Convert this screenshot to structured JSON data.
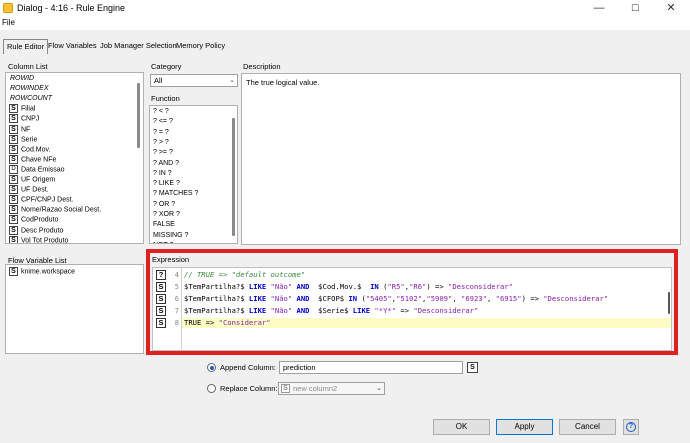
{
  "window": {
    "title": "Dialog - 4:16 - Rule Engine",
    "min": "—",
    "max": "☐",
    "close": "✕"
  },
  "menu": {
    "file": "File"
  },
  "tabs": [
    "Rule Editor",
    "Flow Variables",
    "Job Manager Selection",
    "Memory Policy"
  ],
  "column_list": {
    "label": "Column List",
    "items": [
      {
        "badge": "",
        "name": "ROWID",
        "italic": true
      },
      {
        "badge": "",
        "name": "ROWINDEX",
        "italic": true
      },
      {
        "badge": "",
        "name": "ROWCOUNT",
        "italic": true
      },
      {
        "badge": "S",
        "name": "Filial"
      },
      {
        "badge": "S",
        "name": "CNPJ"
      },
      {
        "badge": "S",
        "name": "NF"
      },
      {
        "badge": "S",
        "name": "Serie"
      },
      {
        "badge": "S",
        "name": "Cod.Mov."
      },
      {
        "badge": "S",
        "name": "Chave NFe"
      },
      {
        "badge": "D",
        "name": "Data Emissao"
      },
      {
        "badge": "S",
        "name": "UF Origem"
      },
      {
        "badge": "S",
        "name": "UF Dest."
      },
      {
        "badge": "S",
        "name": "CPF/CNPJ Dest."
      },
      {
        "badge": "S",
        "name": "Nome/Razao Social Dest."
      },
      {
        "badge": "S",
        "name": "CodProduto"
      },
      {
        "badge": "S",
        "name": "Desc Produto"
      },
      {
        "badge": "S",
        "name": "Vol Tot Produto"
      }
    ]
  },
  "category": {
    "label": "Category",
    "value": "All"
  },
  "function": {
    "label": "Function",
    "items": [
      "? < ?",
      "? <= ?",
      "? = ?",
      "? > ?",
      "? >= ?",
      "? AND ?",
      "? IN ?",
      "? LIKE ?",
      "? MATCHES ?",
      "? OR ?",
      "? XOR ?",
      "FALSE",
      "MISSING ?",
      "NOT ?"
    ]
  },
  "description": {
    "label": "Description",
    "text": "The true logical value."
  },
  "flow_variables": {
    "label": "Flow Variable List",
    "items": [
      {
        "badge": "S",
        "name": "knime.workspace"
      }
    ]
  },
  "expression": {
    "label": "Expression",
    "lines": [
      {
        "no": "4",
        "badge": "?",
        "tokens": [
          [
            "c-comment",
            "// TRUE => \"default outcome\""
          ]
        ]
      },
      {
        "no": "5",
        "badge": "S",
        "tokens": [
          [
            "c-field",
            "$TemPartilha?$ "
          ],
          [
            "c-kw",
            "LIKE"
          ],
          [
            "c-str",
            " \"Não\" "
          ],
          [
            "c-kw",
            "AND"
          ],
          [
            "c-field",
            "  $Cod.Mov.$  "
          ],
          [
            "c-kw",
            "IN"
          ],
          [
            "c-field",
            " ("
          ],
          [
            "c-str",
            "\"R5\""
          ],
          [
            "c-field",
            ","
          ],
          [
            "c-str",
            "\"R6\""
          ],
          [
            "c-field",
            ") => "
          ],
          [
            "c-str",
            "\"Desconsiderar\""
          ]
        ]
      },
      {
        "no": "6",
        "badge": "S",
        "tokens": [
          [
            "c-field",
            "$TemPartilha?$ "
          ],
          [
            "c-kw",
            "LIKE"
          ],
          [
            "c-str",
            " \"Não\" "
          ],
          [
            "c-kw",
            "AND"
          ],
          [
            "c-field",
            "  $CFOP$ "
          ],
          [
            "c-kw",
            "IN"
          ],
          [
            "c-field",
            " ("
          ],
          [
            "c-str",
            "\"5405\""
          ],
          [
            "c-field",
            ","
          ],
          [
            "c-str",
            "\"5102\""
          ],
          [
            "c-field",
            ","
          ],
          [
            "c-str",
            "\"5909\""
          ],
          [
            "c-field",
            ", "
          ],
          [
            "c-str",
            "\"6923\""
          ],
          [
            "c-field",
            ", "
          ],
          [
            "c-str",
            "\"6915\""
          ],
          [
            "c-field",
            ") => "
          ],
          [
            "c-str",
            "\"Desconsiderar\""
          ]
        ]
      },
      {
        "no": "7",
        "badge": "S",
        "tokens": [
          [
            "c-field",
            "$TemPartilha?$ "
          ],
          [
            "c-kw",
            "LIKE"
          ],
          [
            "c-str",
            " \"Não\" "
          ],
          [
            "c-kw",
            "AND"
          ],
          [
            "c-field",
            "  $Serie$ "
          ],
          [
            "c-kw",
            "LIKE"
          ],
          [
            "c-str",
            " \"*Y*\""
          ],
          [
            "c-field",
            " => "
          ],
          [
            "c-str",
            "\"Desconsiderar\""
          ]
        ]
      },
      {
        "no": "8",
        "badge": "S",
        "tokens": [
          [
            "c-true",
            "TRUE => "
          ],
          [
            "c-str",
            "\"Considerar\""
          ]
        ]
      }
    ]
  },
  "append_column": {
    "label": "Append Column:",
    "value": "prediction",
    "badge": "S"
  },
  "replace_column": {
    "label": "Replace Column:",
    "value": "new column2",
    "badge": "S"
  },
  "buttons": {
    "ok": "OK",
    "apply": "Apply",
    "cancel": "Cancel",
    "help": "?"
  },
  "colors": {
    "highlight_border": "#e02020",
    "accent": "#1a5fc4"
  }
}
